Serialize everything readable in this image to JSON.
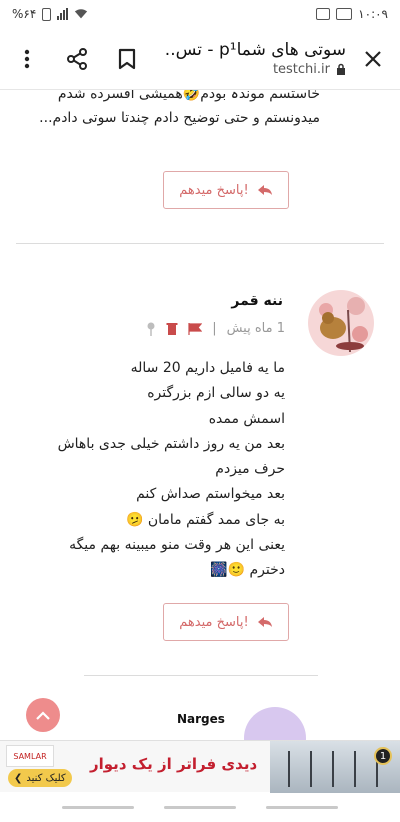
{
  "status": {
    "time": "۱۰:۰۹",
    "battery": "%۶۴"
  },
  "browser": {
    "title": "سوتی های شماp¹ - تس..",
    "domain": "testchi.ir"
  },
  "previous_comment": {
    "text": "خاستسم موندہ بودم🤣همیشی افسرده شدم میدونستم و حتی توضیح دادم چندتا سوتی دادم..."
  },
  "reply_label": "پاسخ میدهم!",
  "comment": {
    "author": "ننه قمر",
    "time": "1 ماه پیش",
    "separator": "|",
    "lines": [
      "ما یه فامیل داریم 20 ساله",
      "یه دو سالی ازم بزرگتره",
      "اسمش ممده",
      "بعد من یه روز داشتم خیلی جدی باهاش",
      "حرف میزدم",
      "بعد میخواستم صداش کنم",
      "به جای ممد گفتم مامان 🫤",
      "یعنی این هر وقت منو میبینه بهم میگه",
      "دخترم 🙂🎆"
    ]
  },
  "next_comment": {
    "author": "Narges"
  },
  "ad": {
    "text": "دیدی فراتر از یک دیوار",
    "cta": "کلیک کنید",
    "brand": "SAMLAR",
    "badge": "1"
  },
  "colors": {
    "accent": "#d46a6a",
    "scroll_button": "#ee8c8c",
    "ad_text": "#c31f2f"
  }
}
